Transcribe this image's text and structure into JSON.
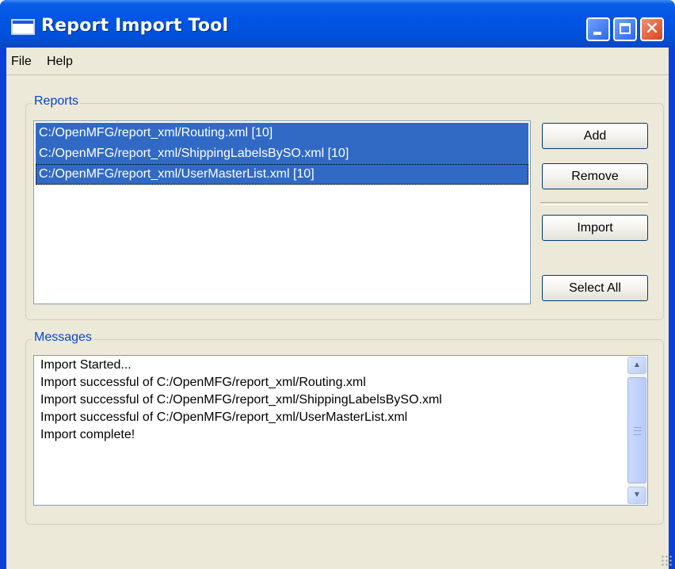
{
  "window": {
    "title": "Report Import Tool",
    "controls": {
      "minimize": "minimize",
      "maximize": "maximize",
      "close": "✕"
    }
  },
  "menu": {
    "items": [
      "File",
      "Help"
    ]
  },
  "reports": {
    "group_title": "Reports",
    "items": [
      "C:/OpenMFG/report_xml/Routing.xml [10]",
      "C:/OpenMFG/report_xml/ShippingLabelsBySO.xml [10]",
      "C:/OpenMFG/report_xml/UserMasterList.xml [10]"
    ],
    "buttons": {
      "add": "Add",
      "remove": "Remove",
      "import": "Import",
      "select_all": "Select All"
    }
  },
  "messages": {
    "group_title": "Messages",
    "lines": [
      "Import Started...",
      "Import successful of C:/OpenMFG/report_xml/Routing.xml",
      "Import successful of C:/OpenMFG/report_xml/ShippingLabelsBySO.xml",
      "Import successful of C:/OpenMFG/report_xml/UserMasterList.xml",
      "Import complete!"
    ]
  },
  "colors": {
    "title_bar": "#0055e5",
    "selection": "#316ac5",
    "group_title": "#0046d5",
    "window_face": "#ece9d8"
  },
  "icons": {
    "app": "window-app-icon",
    "scroll_up": "chevron-up-icon",
    "scroll_down": "chevron-down-icon"
  }
}
